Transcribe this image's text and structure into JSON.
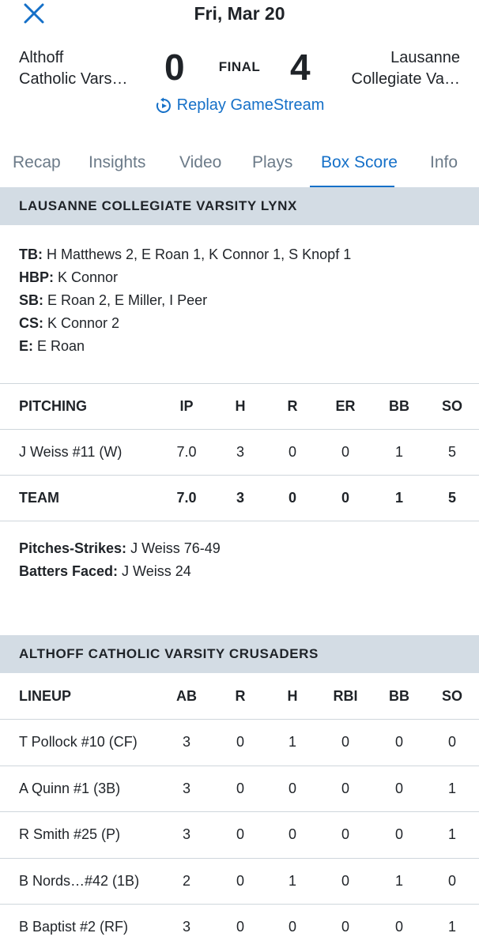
{
  "header": {
    "date": "Fri, Mar 20",
    "status": "FINAL",
    "home": {
      "line1": "Althoff",
      "line2": "Catholic Vars…",
      "score": "0"
    },
    "away": {
      "line1": "Lausanne",
      "line2": "Collegiate Va…",
      "score": "4"
    },
    "replay_label": "Replay GameStream",
    "accent_color": "#1570c8"
  },
  "tabs": [
    "Recap",
    "Insights",
    "Video",
    "Plays",
    "Box Score",
    "Info"
  ],
  "active_tab": "Box Score",
  "lausanne": {
    "section_title": "LAUSANNE COLLEGIATE VARSITY LYNX",
    "notes": [
      {
        "key": "TB:",
        "value": " H Matthews 2, E Roan 1, K Connor 1, S Knopf 1"
      },
      {
        "key": "HBP:",
        "value": " K Connor"
      },
      {
        "key": "SB:",
        "value": " E Roan 2, E Miller, I Peer"
      },
      {
        "key": "CS:",
        "value": " K Connor 2"
      },
      {
        "key": "E:",
        "value": " E Roan"
      }
    ],
    "pitching": {
      "headers": [
        "PITCHING",
        "IP",
        "H",
        "R",
        "ER",
        "BB",
        "SO"
      ],
      "rows": [
        [
          "J Weiss #11 (W)",
          "7.0",
          "3",
          "0",
          "0",
          "1",
          "5"
        ]
      ],
      "total": [
        "TEAM",
        "7.0",
        "3",
        "0",
        "0",
        "1",
        "5"
      ]
    },
    "extra_notes": [
      {
        "key": "Pitches-Strikes:",
        "value": " J Weiss 76-49"
      },
      {
        "key": "Batters Faced:",
        "value": " J Weiss 24"
      }
    ]
  },
  "althoff": {
    "section_title": "ALTHOFF CATHOLIC VARSITY CRUSADERS",
    "lineup": {
      "headers": [
        "LINEUP",
        "AB",
        "R",
        "H",
        "RBI",
        "BB",
        "SO"
      ],
      "rows": [
        [
          "T Pollock #10 (CF)",
          "3",
          "0",
          "1",
          "0",
          "0",
          "0"
        ],
        [
          "A Quinn #1 (3B)",
          "3",
          "0",
          "0",
          "0",
          "0",
          "1"
        ],
        [
          "R Smith #25 (P)",
          "3",
          "0",
          "0",
          "0",
          "0",
          "1"
        ],
        [
          "B Nords…#42 (1B)",
          "2",
          "0",
          "1",
          "0",
          "1",
          "0"
        ],
        [
          "B Baptist #2 (RF)",
          "3",
          "0",
          "0",
          "0",
          "0",
          "1"
        ]
      ]
    }
  }
}
